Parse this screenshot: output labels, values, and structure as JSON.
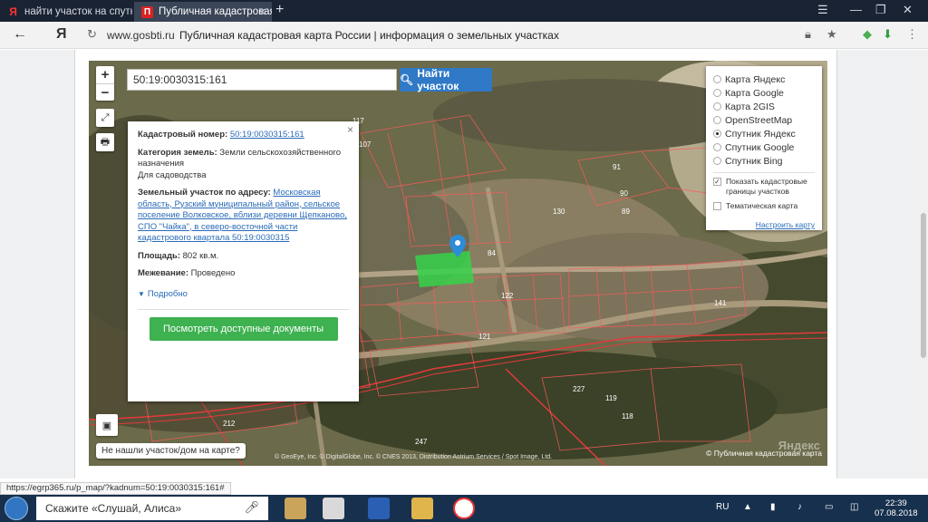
{
  "browser": {
    "tabs": [
      {
        "favicon": "Я",
        "title": "найти участок на спутнико"
      },
      {
        "favicon": "П",
        "title": "Публичная кадастровая"
      }
    ],
    "new_tab": "+",
    "window_controls": [
      "☰",
      "—",
      "❐",
      "✕"
    ],
    "address": {
      "host": "www.gosbti.ru",
      "page_title": "Публичная кадастровая карта России | информация о земельных участках"
    },
    "status_url": "https://egrp365.ru/p_map/?kadnum=50:19:0030315:161#"
  },
  "map": {
    "zoom_in": "+",
    "zoom_out": "−",
    "search": {
      "value": "50:19:0030315:161",
      "button": "Найти участок"
    },
    "layers": {
      "options": [
        {
          "label": "Карта Яндекс",
          "selected": false
        },
        {
          "label": "Карта Google",
          "selected": false
        },
        {
          "label": "Карта 2GIS",
          "selected": false
        },
        {
          "label": "OpenStreetMap",
          "selected": false
        },
        {
          "label": "Спутник Яндекс",
          "selected": true
        },
        {
          "label": "Спутник Google",
          "selected": false
        },
        {
          "label": "Спутник Bing",
          "selected": false
        }
      ],
      "checkboxes": [
        {
          "label": "Показать кадастровые границы участков",
          "checked": true
        },
        {
          "label": "Тематическая карта",
          "checked": false
        }
      ],
      "setup_link": "Настроить карту"
    },
    "popup": {
      "close": "×",
      "cad_label": "Кадастровый номер:",
      "cad_value": "50:19:0030315:161",
      "category_label": "Категория земель:",
      "category_value": "Земли сельскохозяйственного назначения",
      "use_value": "Для садоводства",
      "address_label": "Земельный участок по адресу:",
      "address_value": "Московская область, Рузский муниципальный район, сельское поселение Волковское, вблизи деревни Щепканово, СПО \"Чайка\", в северо-восточной части кадастрового квартала 50:19:0030315",
      "area_label": "Площадь:",
      "area_value": "802 кв.м.",
      "survey_label": "Межевание:",
      "survey_value": "Проведено",
      "more": "Подробно",
      "docs_button": "Посмотреть доступные документы"
    },
    "not_found": "Не нашли участок/дом на карте?",
    "attribution": "© GeoEye, Inc. © DigitalGlobe, Inc. © CNES 2013, Distribution Astrium Services / Spot Image, Ltd.",
    "copyright": "© Публичная кадастровая карта",
    "watermark": "Яндекс",
    "parcel_numbers": [
      "117",
      "107",
      "91",
      "90",
      "130",
      "89",
      "84",
      "122",
      "121",
      "141",
      "227",
      "119",
      "118",
      "247",
      "212",
      "81"
    ]
  },
  "taskbar": {
    "alice_placeholder": "Скажите «Слушай, Алиса»",
    "lang": "RU",
    "time": "22:39",
    "date": "07.08.2018"
  },
  "colors": {
    "search_button": "#2f79c6",
    "docs_button": "#3eb150",
    "link": "#2a6bb8",
    "parcel_selected": "#35d24a",
    "boundary": "#e23a3a",
    "taskbar": "#17304d"
  }
}
